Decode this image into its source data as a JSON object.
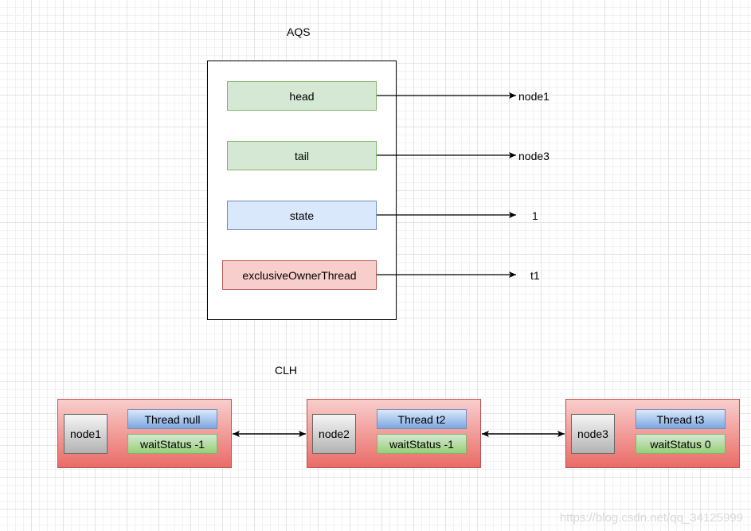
{
  "aqs": {
    "title": "AQS",
    "fields": [
      {
        "label": "head",
        "target": "node1"
      },
      {
        "label": "tail",
        "target": "node3"
      },
      {
        "label": "state",
        "target": "1"
      },
      {
        "label": "exclusiveOwnerThread",
        "target": "t1"
      }
    ]
  },
  "clh": {
    "title": "CLH",
    "nodes": [
      {
        "name": "node1",
        "thread": "Thread null",
        "wait_status": "waitStatus -1"
      },
      {
        "name": "node2",
        "thread": "Thread t2",
        "wait_status": "waitStatus -1"
      },
      {
        "name": "node3",
        "thread": "Thread t3",
        "wait_status": "waitStatus 0"
      }
    ]
  },
  "watermark": "https://blog.csdn.net/qq_34125999",
  "colors": {
    "green_fill": "#d5e8d4",
    "blue_fill": "#dae8fc",
    "red_fill": "#f8cecc",
    "node_red": "#ea6b66"
  }
}
